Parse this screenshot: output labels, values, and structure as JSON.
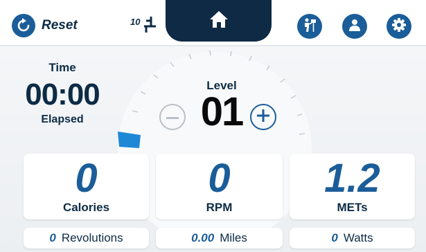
{
  "header": {
    "reset_label": "Reset",
    "seat_number": "10",
    "icons": [
      "reset-icon",
      "seat-icon",
      "home-icon",
      "workout-person-icon",
      "user-profile-icon",
      "settings-gear-icon"
    ]
  },
  "time": {
    "label": "Time",
    "value": "00:00",
    "sub_label": "Elapsed"
  },
  "level": {
    "label": "Level",
    "value": "01"
  },
  "stats": [
    {
      "value": "0",
      "label": "Calories"
    },
    {
      "value": "0",
      "label": "RPM"
    },
    {
      "value": "1.2",
      "label": "METs"
    }
  ],
  "secondary_stats": [
    {
      "value": "0",
      "label": "Revolutions"
    },
    {
      "value": "0.00",
      "label": "Miles"
    },
    {
      "value": "0",
      "label": "Watts"
    }
  ],
  "colors": {
    "primary_blue": "#1b5d99",
    "navy": "#0e2a44",
    "indicator_blue": "#1e88d6"
  }
}
